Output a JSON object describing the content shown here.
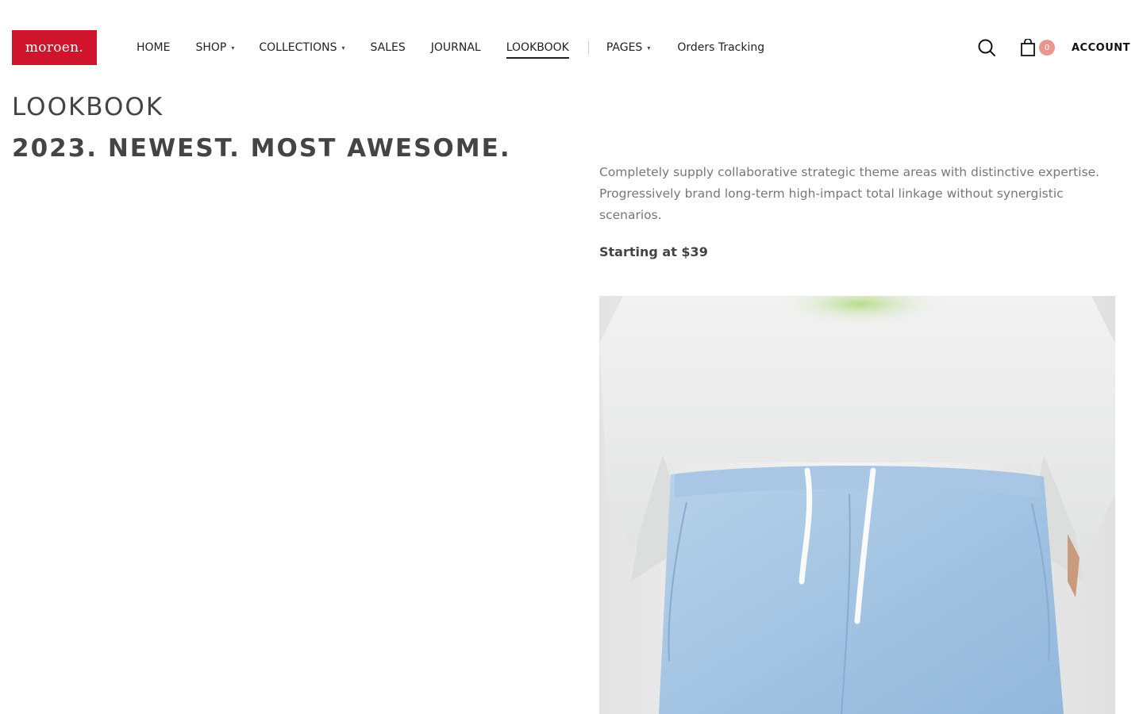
{
  "header": {
    "logo_text": "moroen.",
    "nav": [
      {
        "label": "HOME",
        "has_caret": false
      },
      {
        "label": "SHOP",
        "has_caret": true
      },
      {
        "label": "COLLECTIONS",
        "has_caret": true
      },
      {
        "label": "SALES",
        "has_caret": false
      },
      {
        "label": "JOURNAL",
        "has_caret": false
      },
      {
        "label": "LOOKBOOK",
        "has_caret": false,
        "active": true
      },
      {
        "label": "PAGES",
        "has_caret": true
      },
      {
        "label": "Orders Tracking",
        "has_caret": false
      }
    ],
    "caret_glyph": "▾",
    "cart_count": "0",
    "account_label": "ACCOUNT",
    "icons": {
      "search": "search-icon",
      "cart": "shopping-bag-icon"
    }
  },
  "main": {
    "title": "LOOKBOOK",
    "subtitle": "2023. NEWEST. MOST AWESOME.",
    "description": "Completely supply collaborative strategic theme areas with distinctive expertise. Progressively brand long-term high-impact total linkage without synergistic scenarios.",
    "price_text": "Starting at $39"
  },
  "colors": {
    "brand": "#d0142c",
    "cart_badge": "#e8968f",
    "text": "#222222",
    "muted": "#777777"
  }
}
